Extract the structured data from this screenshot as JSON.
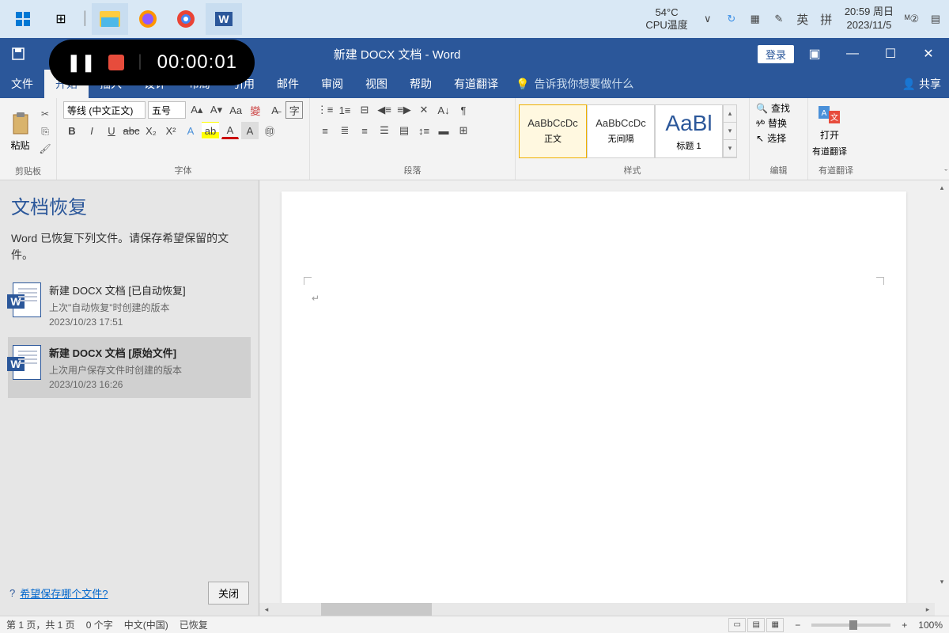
{
  "taskbar": {
    "cpu_temp_value": "54°C",
    "cpu_temp_label": "CPU温度",
    "ime_lang": "英",
    "ime_mode": "拼",
    "time": "20:59",
    "weekday": "周日",
    "date": "2023/11/5"
  },
  "recorder": {
    "time": "00:00:01"
  },
  "title": {
    "doc": "新建 DOCX 文档",
    "app": "Word",
    "login": "登录"
  },
  "tabs": {
    "file": "文件",
    "home": "开始",
    "insert": "插入",
    "design": "设计",
    "layout": "布局",
    "references": "引用",
    "mailings": "邮件",
    "review": "审阅",
    "view": "视图",
    "help": "帮助",
    "youdao": "有道翻译",
    "tellme": "告诉我你想要做什么",
    "share": "共享"
  },
  "ribbon": {
    "clipboard": {
      "paste": "粘贴",
      "label": "剪贴板"
    },
    "font": {
      "family": "等线 (中文正文)",
      "size": "五号",
      "label": "字体"
    },
    "paragraph": {
      "label": "段落"
    },
    "styles": {
      "sample": "AaBbCcDc",
      "normal": "正文",
      "nospacing": "无间隔",
      "heading1_sample": "AaBl",
      "heading1": "标题 1",
      "label": "样式"
    },
    "editing": {
      "find": "查找",
      "replace": "替换",
      "select": "选择",
      "label": "编辑"
    },
    "translate": {
      "open": "打开",
      "line1": "有道翻译",
      "label": "有道翻译"
    }
  },
  "recovery": {
    "title": "文档恢复",
    "message": "Word 已恢复下列文件。请保存希望保留的文件。",
    "items": [
      {
        "name": "新建 DOCX 文档  [已自动恢复]",
        "desc": "上次\"自动恢复\"时创建的版本",
        "date": "2023/10/23 17:51"
      },
      {
        "name": "新建 DOCX 文档  [原始文件]",
        "desc": "上次用户保存文件时创建的版本",
        "date": "2023/10/23 16:26"
      }
    ],
    "help": "希望保存哪个文件?",
    "close": "关闭"
  },
  "statusbar": {
    "page": "第 1 页，共 1 页",
    "words": "0 个字",
    "lang": "中文(中国)",
    "recovered": "已恢复",
    "zoom": "100%"
  }
}
